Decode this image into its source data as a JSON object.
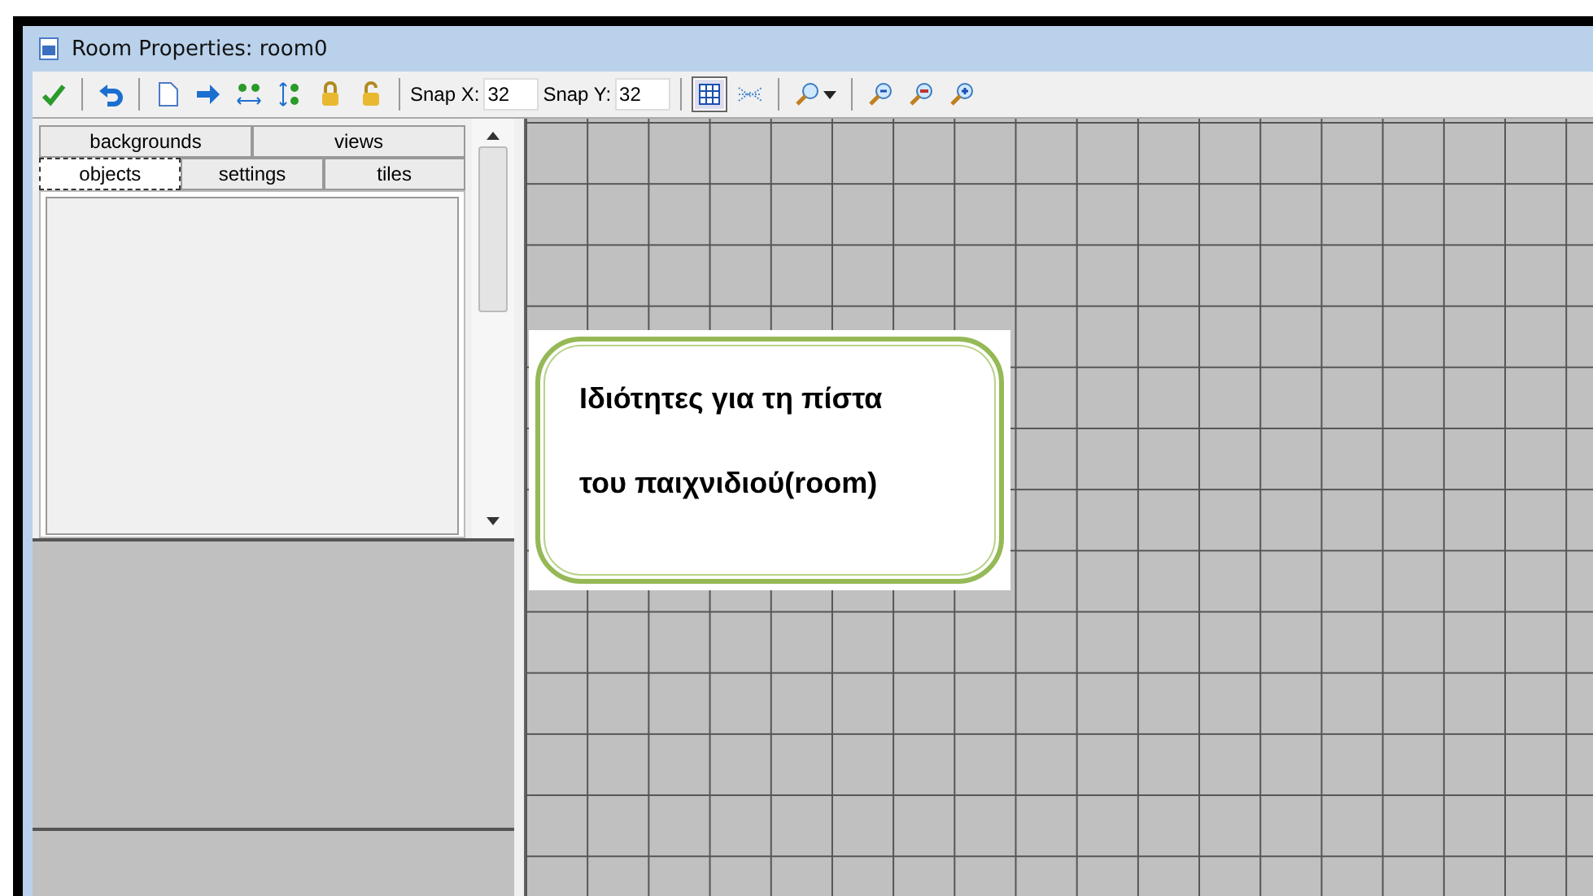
{
  "window": {
    "title": "Room Properties: room0"
  },
  "toolbar": {
    "items": [
      {
        "kind": "icon"
      },
      {
        "kind": "sep"
      },
      {
        "kind": "icon"
      },
      {
        "kind": "sep"
      },
      {
        "kind": "icon"
      },
      {
        "kind": "icon"
      },
      {
        "kind": "icon"
      },
      {
        "kind": "icon"
      },
      {
        "kind": "icon"
      },
      {
        "kind": "icon"
      },
      {
        "kind": "sep"
      },
      {
        "kind": "snap",
        "label": "Snap X:",
        "value": "32"
      },
      {
        "kind": "snap",
        "label": "Snap Y:",
        "value": "32"
      },
      {
        "kind": "sep"
      },
      {
        "kind": "toggle",
        "selected": true
      },
      {
        "kind": "toggle",
        "selected": false
      },
      {
        "kind": "sep"
      },
      {
        "kind": "icon"
      },
      {
        "kind": "sep"
      },
      {
        "kind": "icon"
      },
      {
        "kind": "icon"
      },
      {
        "kind": "icon"
      }
    ]
  },
  "tabs": [
    [
      {
        "label": "backgrounds",
        "selected": false
      },
      {
        "label": "views",
        "selected": false
      }
    ],
    [
      {
        "label": "objects",
        "selected": true
      },
      {
        "label": "settings",
        "selected": false
      },
      {
        "label": "tiles",
        "selected": false
      }
    ]
  ],
  "note": {
    "lines": [
      "Ιδιότητες για τη πίστα",
      "του παιχνιδιού(room)"
    ]
  }
}
